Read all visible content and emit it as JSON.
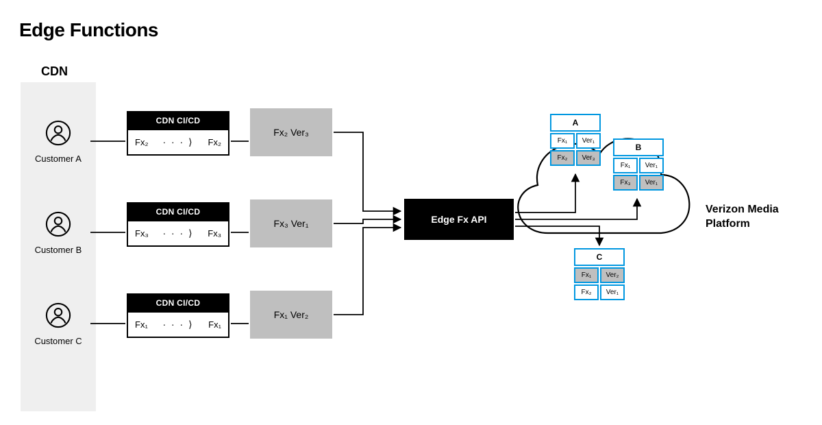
{
  "title": "Edge Functions",
  "cdn_label": "CDN",
  "customers": [
    {
      "label": "Customer A",
      "cicd_header": "CDN CI/CD",
      "cicd_from": "Fx₂",
      "cicd_to": "Fx₂",
      "artifact": "Fx₂ Ver₃"
    },
    {
      "label": "Customer B",
      "cicd_header": "CDN CI/CD",
      "cicd_from": "Fx₃",
      "cicd_to": "Fx₃",
      "artifact": "Fx₃ Ver₁"
    },
    {
      "label": "Customer C",
      "cicd_header": "CDN CI/CD",
      "cicd_from": "Fx₁",
      "cicd_to": "Fx₁",
      "artifact": "Fx₁ Ver₂"
    }
  ],
  "api_label": "Edge Fx API",
  "pods": {
    "a": {
      "header": "A",
      "rows": [
        [
          "Fx₁",
          "Ver₁",
          false
        ],
        [
          "Fx₂",
          "Ver₃",
          true
        ]
      ]
    },
    "b": {
      "header": "B",
      "rows": [
        [
          "Fx₁",
          "Ver₁",
          false
        ],
        [
          "Fx₃",
          "Ver₁",
          true
        ]
      ]
    },
    "c": {
      "header": "C",
      "rows": [
        [
          "Fx₁",
          "Ver₂",
          true
        ],
        [
          "Fx₂",
          "Ver₁",
          false
        ]
      ]
    }
  },
  "vmp_label": "Verizon Media Platform",
  "dots_arrow": "· · · ⟩"
}
